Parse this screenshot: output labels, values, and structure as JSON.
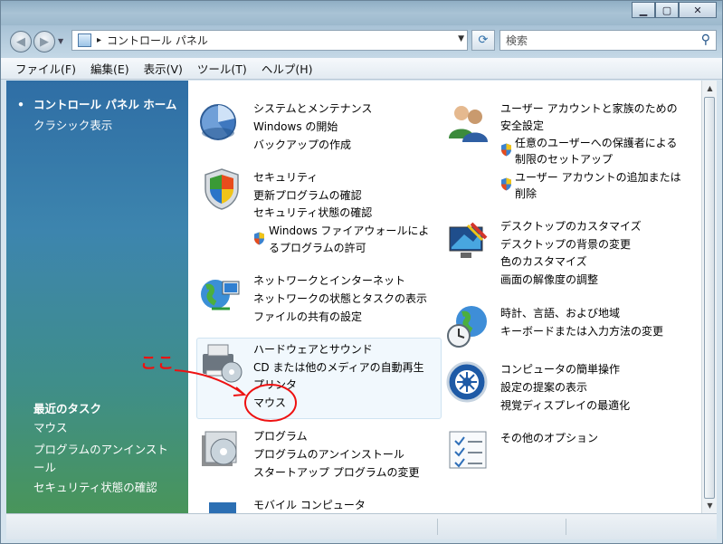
{
  "window": {
    "controls": {
      "minimize": "▁",
      "maximize": "▢",
      "close": "✕"
    }
  },
  "address": {
    "breadcrumb_separator": "▸",
    "path": "コントロール パネル",
    "search_placeholder": "検索"
  },
  "menu": [
    "ファイル(F)",
    "編集(E)",
    "表示(V)",
    "ツール(T)",
    "ヘルプ(H)"
  ],
  "sidebar": {
    "home": "コントロール パネル ホーム",
    "classic": "クラシック表示",
    "recent_heading": "最近のタスク",
    "recent": [
      "マウス",
      "プログラムのアンインストール",
      "セキュリティ状態の確認"
    ]
  },
  "categories": {
    "system": {
      "head": "システムとメンテナンス",
      "links": [
        "Windows の開始",
        "バックアップの作成"
      ]
    },
    "security": {
      "head": "セキュリティ",
      "links": [
        "更新プログラムの確認",
        "セキュリティ状態の確認",
        "Windows ファイアウォールによ",
        "るプログラムの許可"
      ]
    },
    "network": {
      "head": "ネットワークとインターネット",
      "links": [
        "ネットワークの状態とタスクの表示",
        "ファイルの共有の設定"
      ]
    },
    "hardware": {
      "head": "ハードウェアとサウンド",
      "links": [
        "CD または他のメディアの自動再生",
        "プリンタ",
        "マウス"
      ]
    },
    "programs": {
      "head": "プログラム",
      "links": [
        "プログラムのアンインストール",
        "スタートアップ プログラムの変更"
      ]
    },
    "mobile": {
      "head": "モバイル コンピュータ"
    },
    "users": {
      "head": [
        "ユーザー アカウントと家族のための",
        "安全設定"
      ],
      "links": [
        "任意のユーザーへの保護者による",
        "制限のセットアップ",
        "ユーザー アカウントの追加または",
        "削除"
      ]
    },
    "appearance": {
      "head": "デスクトップのカスタマイズ",
      "links": [
        "デスクトップの背景の変更",
        "色のカスタマイズ",
        "画面の解像度の調整"
      ]
    },
    "clock": {
      "head": "時計、言語、および地域",
      "links": [
        "キーボードまたは入力方法の変更"
      ]
    },
    "ease": {
      "head": "コンピュータの簡単操作",
      "links": [
        "設定の提案の表示",
        "視覚ディスプレイの最適化"
      ]
    },
    "other": {
      "head": "その他のオプション"
    }
  },
  "annotation": {
    "text": "ここ",
    "color": "#ee1111"
  },
  "colors": {
    "heading_green": "#1a7f25",
    "link_blue": "#0c5fbe"
  }
}
